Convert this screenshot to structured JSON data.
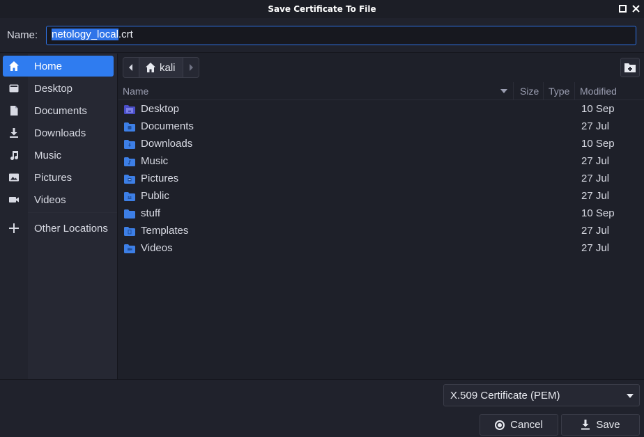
{
  "window": {
    "title": "Save Certificate To File"
  },
  "name_row": {
    "label": "Name:",
    "value_selected": "netology_local",
    "value_rest": ".crt"
  },
  "sidebar": {
    "items": [
      {
        "label": "Home",
        "icon": "home-icon",
        "active": true
      },
      {
        "label": "Desktop",
        "icon": "desktop-icon"
      },
      {
        "label": "Documents",
        "icon": "document-icon"
      },
      {
        "label": "Downloads",
        "icon": "download-icon"
      },
      {
        "label": "Music",
        "icon": "music-icon"
      },
      {
        "label": "Pictures",
        "icon": "pictures-icon"
      },
      {
        "label": "Videos",
        "icon": "video-icon"
      },
      {
        "label": "Other Locations",
        "icon": "plus-icon"
      }
    ]
  },
  "pathbar": {
    "crumb": "kali"
  },
  "columns": {
    "name": "Name",
    "size": "Size",
    "type": "Type",
    "modified": "Modified"
  },
  "files": [
    {
      "name": "Desktop",
      "modified": "10 Sep"
    },
    {
      "name": "Documents",
      "modified": "27 Jul"
    },
    {
      "name": "Downloads",
      "modified": "10 Sep"
    },
    {
      "name": "Music",
      "modified": "27 Jul"
    },
    {
      "name": "Pictures",
      "modified": "27 Jul"
    },
    {
      "name": "Public",
      "modified": "27 Jul"
    },
    {
      "name": "stuff",
      "modified": "10 Sep"
    },
    {
      "name": "Templates",
      "modified": "27 Jul"
    },
    {
      "name": "Videos",
      "modified": "27 Jul"
    }
  ],
  "filter": {
    "selected": "X.509 Certificate (PEM)"
  },
  "buttons": {
    "cancel": "Cancel",
    "save": "Save"
  },
  "colors": {
    "accent": "#2f7cf0",
    "background": "#1e2029",
    "folder": "#3d7fe6"
  }
}
